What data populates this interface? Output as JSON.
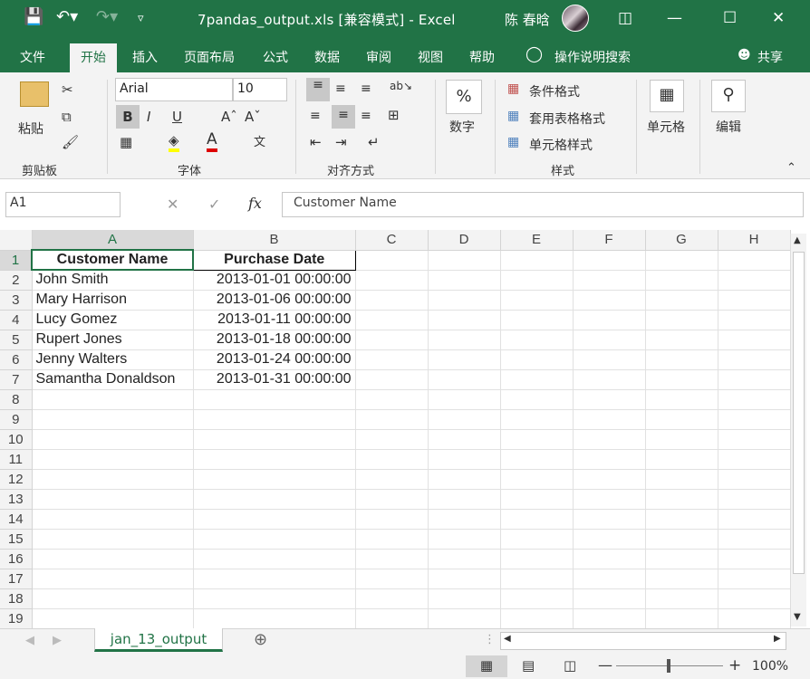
{
  "window": {
    "title": "7pandas_output.xls  [兼容模式]  -  Excel",
    "user": "陈 春晗",
    "share": "共享",
    "tell_me": "操作说明搜索"
  },
  "tabs": [
    "文件",
    "开始",
    "插入",
    "页面布局",
    "公式",
    "数据",
    "审阅",
    "视图",
    "帮助"
  ],
  "ribbon": {
    "paste": "粘贴",
    "clipboard": "剪贴板",
    "font_group": "字体",
    "font_name": "Arial",
    "font_size": "10",
    "align_group": "对齐方式",
    "number": "数字",
    "number_symbol": "%",
    "cond_format": "条件格式",
    "table_format": "套用表格格式",
    "cell_style": "单元格样式",
    "styles_group": "样式",
    "cells": "单元格",
    "edit": "编辑"
  },
  "formula_bar": {
    "name_box": "A1",
    "content": "Customer Name"
  },
  "columns": [
    "A",
    "B",
    "C",
    "D",
    "E",
    "F",
    "G",
    "H"
  ],
  "headers": [
    "Customer Name",
    "Purchase Date"
  ],
  "rows": [
    [
      "John Smith",
      "2013-01-01 00:00:00"
    ],
    [
      "Mary Harrison",
      "2013-01-06 00:00:00"
    ],
    [
      "Lucy Gomez",
      "2013-01-11 00:00:00"
    ],
    [
      "Rupert Jones",
      "2013-01-18 00:00:00"
    ],
    [
      "Jenny Walters",
      "2013-01-24 00:00:00"
    ],
    [
      "Samantha Donaldson",
      "2013-01-31 00:00:00"
    ]
  ],
  "sheet_tab": "jan_13_output",
  "zoom": "100%",
  "colors": {
    "accent": "#217346",
    "ribbon_bg": "#f3f3f3"
  }
}
